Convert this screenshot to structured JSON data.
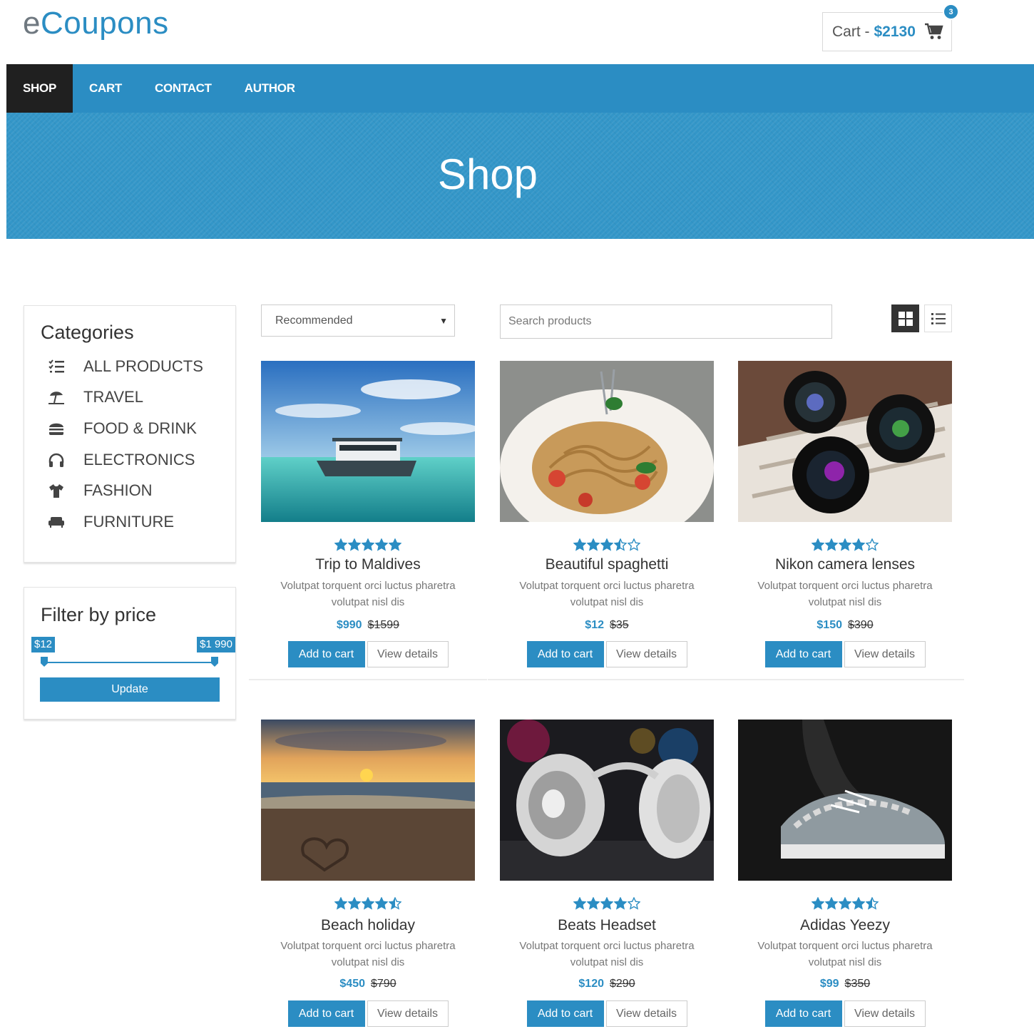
{
  "brand": {
    "logo_e": "e",
    "logo_rest": "Coupons"
  },
  "cart": {
    "label": "Cart - ",
    "total": "$2130",
    "count": "3",
    "icon": "shopping-cart-icon"
  },
  "nav": {
    "items": [
      {
        "label": "SHOP",
        "active": true
      },
      {
        "label": "CART"
      },
      {
        "label": "CONTACT"
      },
      {
        "label": "AUTHOR"
      }
    ]
  },
  "hero": {
    "title": "Shop"
  },
  "sidebar": {
    "categories_title": "Categories",
    "categories": [
      {
        "label": "ALL PRODUCTS",
        "icon": "list-icon"
      },
      {
        "label": "TRAVEL",
        "icon": "beach-umbrella-icon"
      },
      {
        "label": "FOOD & DRINK",
        "icon": "burger-icon"
      },
      {
        "label": "ELECTRONICS",
        "icon": "headphones-icon"
      },
      {
        "label": "FASHION",
        "icon": "tshirt-icon"
      },
      {
        "label": "FURNITURE",
        "icon": "sofa-icon"
      }
    ],
    "filter_title": "Filter by price",
    "price_min": "$12",
    "price_max": "$1 990",
    "update_label": "Update"
  },
  "toolbar": {
    "sort_selected": "Recommended",
    "search_placeholder": "Search products",
    "grid_view_icon": "grid-view-icon",
    "list_view_icon": "list-view-icon"
  },
  "products": [
    {
      "title": "Trip to Maldives",
      "desc": "Volutpat torquent orci luctus pharetra volutpat nisl dis",
      "price": "$990",
      "old_price": "$1599",
      "rating": 5,
      "image": "boat-sea"
    },
    {
      "title": "Beautiful spaghetti",
      "desc": "Volutpat torquent orci luctus pharetra volutpat nisl dis",
      "price": "$12",
      "old_price": "$35",
      "rating": 3.5,
      "image": "spaghetti"
    },
    {
      "title": "Nikon camera lenses",
      "desc": "Volutpat torquent orci luctus pharetra volutpat nisl dis",
      "price": "$150",
      "old_price": "$390",
      "rating": 4,
      "image": "camera-lenses"
    },
    {
      "title": "Beach holiday",
      "desc": "Volutpat torquent orci luctus pharetra volutpat nisl dis",
      "price": "$450",
      "old_price": "$790",
      "rating": 4.5,
      "image": "beach-sunset"
    },
    {
      "title": "Beats Headset",
      "desc": "Volutpat torquent orci luctus pharetra volutpat nisl dis",
      "price": "$120",
      "old_price": "$290",
      "rating": 4,
      "image": "headphones"
    },
    {
      "title": "Adidas Yeezy",
      "desc": "Volutpat torquent orci luctus pharetra volutpat nisl dis",
      "price": "$99",
      "old_price": "$350",
      "rating": 4.5,
      "image": "sneaker"
    }
  ],
  "buttons": {
    "add_to_cart": "Add to cart",
    "view_details": "View details"
  },
  "colors": {
    "accent": "#2b8dc3",
    "nav_active": "#202020",
    "hero": "#3396c8"
  }
}
